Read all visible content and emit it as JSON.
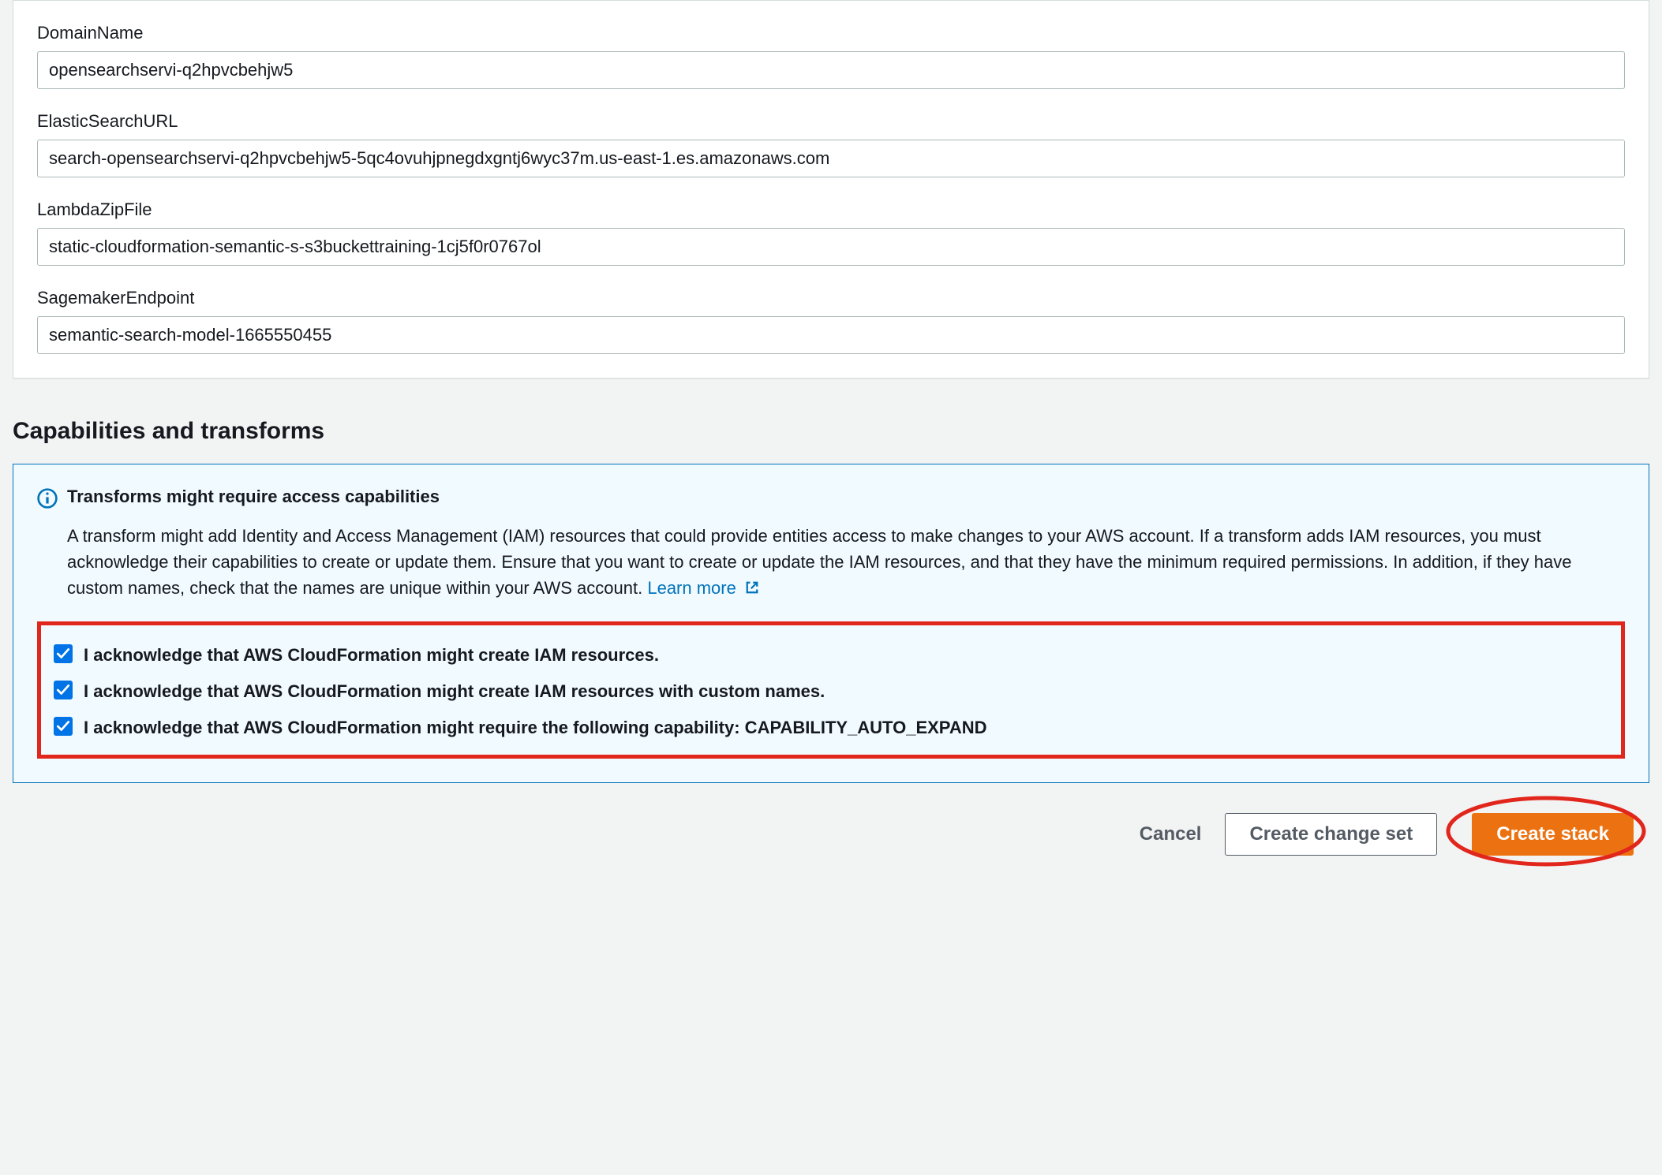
{
  "parameters": {
    "domainName": {
      "label": "DomainName",
      "value": "opensearchservi-q2hpvcbehjw5"
    },
    "elasticSearchURL": {
      "label": "ElasticSearchURL",
      "value": "search-opensearchservi-q2hpvcbehjw5-5qc4ovuhjpnegdxgntj6wyc37m.us-east-1.es.amazonaws.com"
    },
    "lambdaZipFile": {
      "label": "LambdaZipFile",
      "value": "static-cloudformation-semantic-s-s3buckettraining-1cj5f0r0767ol"
    },
    "sagemakerEndpoint": {
      "label": "SagemakerEndpoint",
      "value": "semantic-search-model-1665550455"
    }
  },
  "capabilities": {
    "sectionTitle": "Capabilities and transforms",
    "alertTitle": "Transforms might require access capabilities",
    "alertBody": "A transform might add Identity and Access Management (IAM) resources that could provide entities access to make changes to your AWS account. If a transform adds IAM resources, you must acknowledge their capabilities to create or update them. Ensure that you want to create or update the IAM resources, and that they have the minimum required permissions. In addition, if they have custom names, check that the names are unique within your AWS account. ",
    "learnMore": "Learn more",
    "acknowledgements": [
      {
        "label": "I acknowledge that AWS CloudFormation might create IAM resources.",
        "checked": true
      },
      {
        "label": "I acknowledge that AWS CloudFormation might create IAM resources with custom names.",
        "checked": true
      },
      {
        "label": "I acknowledge that AWS CloudFormation might require the following capability: CAPABILITY_AUTO_EXPAND",
        "checked": true
      }
    ]
  },
  "actions": {
    "cancel": "Cancel",
    "createChangeSet": "Create change set",
    "createStack": "Create stack"
  },
  "colors": {
    "accent": "#0073bb",
    "primaryButton": "#ec7211",
    "highlight": "#e1261c"
  }
}
